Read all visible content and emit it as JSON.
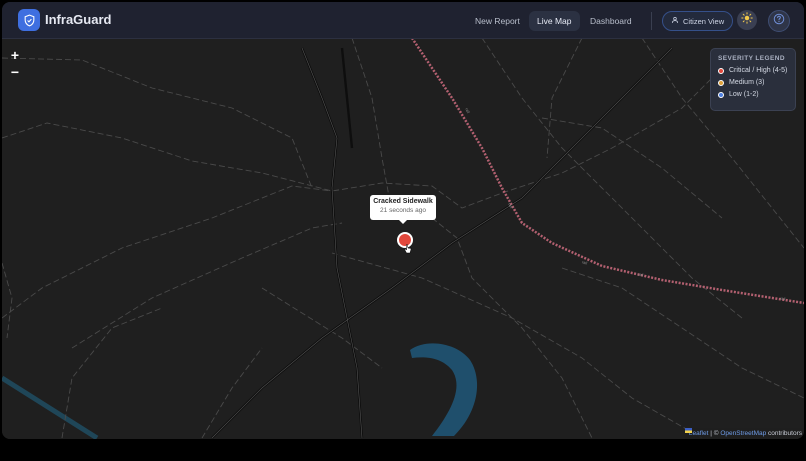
{
  "header": {
    "brand": "InfraGuard",
    "nav": [
      "New Report",
      "Live Map",
      "Dashboard"
    ],
    "active_nav": "Live Map",
    "citizen_view": "Citizen View",
    "icons": {
      "logo": "shield-check-icon",
      "theme": "sun-icon",
      "help": "help-circle-icon",
      "citizen": "user-icon"
    }
  },
  "map": {
    "zoom_in": "+",
    "zoom_out": "−",
    "legend": {
      "title": "SEVERITY LEGEND",
      "items": [
        {
          "label": "Critical / High (4-5)",
          "color": "#e2483c"
        },
        {
          "label": "Medium (3)",
          "color": "#e0a23a"
        },
        {
          "label": "Low (1-2)",
          "color": "#4d7fe0"
        }
      ]
    },
    "popup": {
      "title": "Cracked Sidewalk",
      "time": "21 seconds ago"
    },
    "marker": {
      "severity": "critical",
      "color": "#e2483c"
    },
    "attribution": {
      "leaflet": "Leaflet",
      "separator": " | © ",
      "osm": "OpenStreetMap",
      "suffix": " contributors"
    }
  }
}
